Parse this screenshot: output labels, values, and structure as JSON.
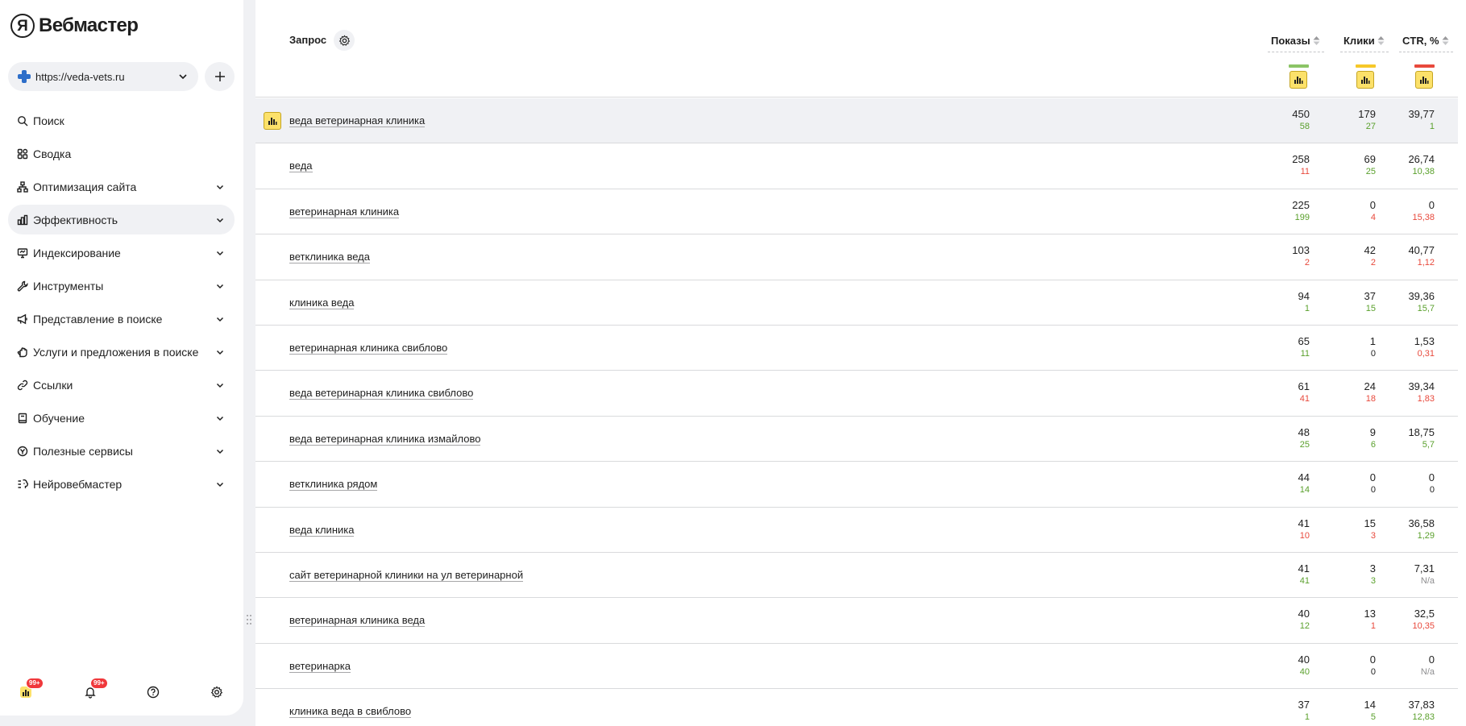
{
  "app": {
    "logo_letter": "Я",
    "title": "Вебмастер"
  },
  "site_selector": {
    "url": "https://veda-vets.ru",
    "add_label": "+"
  },
  "nav": [
    {
      "label": "Поиск",
      "icon": "search-icon",
      "has_chevron": false,
      "active": false
    },
    {
      "label": "Сводка",
      "icon": "grid-icon",
      "has_chevron": false,
      "active": false
    },
    {
      "label": "Оптимизация сайта",
      "icon": "sitemap-icon",
      "has_chevron": true,
      "active": false
    },
    {
      "label": "Эффективность",
      "icon": "bar-chart-icon",
      "has_chevron": true,
      "active": true
    },
    {
      "label": "Индексирование",
      "icon": "monitor-icon",
      "has_chevron": true,
      "active": false
    },
    {
      "label": "Инструменты",
      "icon": "wrench-icon",
      "has_chevron": true,
      "active": false
    },
    {
      "label": "Представление в поиске",
      "icon": "megaphone-icon",
      "has_chevron": true,
      "active": false
    },
    {
      "label": "Услуги и предложения в поиске",
      "icon": "hand-icon",
      "has_chevron": true,
      "active": false
    },
    {
      "label": "Ссылки",
      "icon": "link-icon",
      "has_chevron": true,
      "active": false
    },
    {
      "label": "Обучение",
      "icon": "book-icon",
      "has_chevron": true,
      "active": false
    },
    {
      "label": "Полезные сервисы",
      "icon": "services-icon",
      "has_chevron": true,
      "active": false
    },
    {
      "label": "Нейровебмастер",
      "icon": "neuro-icon",
      "has_chevron": true,
      "active": false
    }
  ],
  "bottom_bar": {
    "reports_badge": "99+",
    "notifications_badge": "99+"
  },
  "table": {
    "query_header": "Запрос",
    "shows_header": "Показы",
    "clicks_header": "Клики",
    "ctr_header": "CTR, %",
    "legend_colors": {
      "shows": "#8bc466",
      "clicks": "#f6c829",
      "ctr": "#e8493c"
    },
    "rows": [
      {
        "query": "веда ветеринарная клиника",
        "shows": "450",
        "shows_delta": "58",
        "shows_trend": "up",
        "clicks": "179",
        "clicks_delta": "27",
        "clicks_trend": "up",
        "ctr": "39,77",
        "ctr_delta": "1",
        "ctr_trend": "up",
        "highlighted": true
      },
      {
        "query": "веда",
        "shows": "258",
        "shows_delta": "11",
        "shows_trend": "down",
        "clicks": "69",
        "clicks_delta": "25",
        "clicks_trend": "up",
        "ctr": "26,74",
        "ctr_delta": "10,38",
        "ctr_trend": "up",
        "highlighted": false
      },
      {
        "query": "ветеринарная клиника",
        "shows": "225",
        "shows_delta": "199",
        "shows_trend": "up",
        "clicks": "0",
        "clicks_delta": "4",
        "clicks_trend": "down",
        "ctr": "0",
        "ctr_delta": "15,38",
        "ctr_trend": "down",
        "highlighted": false
      },
      {
        "query": "ветклиника веда",
        "shows": "103",
        "shows_delta": "2",
        "shows_trend": "down",
        "clicks": "42",
        "clicks_delta": "2",
        "clicks_trend": "down",
        "ctr": "40,77",
        "ctr_delta": "1,12",
        "ctr_trend": "down",
        "highlighted": false
      },
      {
        "query": "клиника веда",
        "shows": "94",
        "shows_delta": "1",
        "shows_trend": "up",
        "clicks": "37",
        "clicks_delta": "15",
        "clicks_trend": "up",
        "ctr": "39,36",
        "ctr_delta": "15,7",
        "ctr_trend": "up",
        "highlighted": false
      },
      {
        "query": "ветеринарная клиника свиблово",
        "shows": "65",
        "shows_delta": "11",
        "shows_trend": "up",
        "clicks": "1",
        "clicks_delta": "0",
        "clicks_trend": "neutral-dark",
        "ctr": "1,53",
        "ctr_delta": "0,31",
        "ctr_trend": "down",
        "highlighted": false
      },
      {
        "query": "веда ветеринарная клиника свиблово",
        "shows": "61",
        "shows_delta": "41",
        "shows_trend": "down",
        "clicks": "24",
        "clicks_delta": "18",
        "clicks_trend": "down",
        "ctr": "39,34",
        "ctr_delta": "1,83",
        "ctr_trend": "down",
        "highlighted": false
      },
      {
        "query": "веда ветеринарная клиника измайлово",
        "shows": "48",
        "shows_delta": "25",
        "shows_trend": "up",
        "clicks": "9",
        "clicks_delta": "6",
        "clicks_trend": "up",
        "ctr": "18,75",
        "ctr_delta": "5,7",
        "ctr_trend": "up",
        "highlighted": false
      },
      {
        "query": "ветклиника рядом",
        "shows": "44",
        "shows_delta": "14",
        "shows_trend": "up",
        "clicks": "0",
        "clicks_delta": "0",
        "clicks_trend": "neutral-dark",
        "ctr": "0",
        "ctr_delta": "0",
        "ctr_trend": "neutral-dark",
        "highlighted": false
      },
      {
        "query": "веда клиника",
        "shows": "41",
        "shows_delta": "10",
        "shows_trend": "down",
        "clicks": "15",
        "clicks_delta": "3",
        "clicks_trend": "down",
        "ctr": "36,58",
        "ctr_delta": "1,29",
        "ctr_trend": "up",
        "highlighted": false
      },
      {
        "query": "сайт ветеринарной клиники на ул ветеринарной",
        "shows": "41",
        "shows_delta": "41",
        "shows_trend": "up",
        "clicks": "3",
        "clicks_delta": "3",
        "clicks_trend": "up",
        "ctr": "7,31",
        "ctr_delta": "N/a",
        "ctr_trend": "neutral",
        "highlighted": false
      },
      {
        "query": "ветеринарная клиника веда",
        "shows": "40",
        "shows_delta": "12",
        "shows_trend": "up",
        "clicks": "13",
        "clicks_delta": "1",
        "clicks_trend": "down",
        "ctr": "32,5",
        "ctr_delta": "10,35",
        "ctr_trend": "down",
        "highlighted": false
      },
      {
        "query": "ветеринарка",
        "shows": "40",
        "shows_delta": "40",
        "shows_trend": "up",
        "clicks": "0",
        "clicks_delta": "0",
        "clicks_trend": "neutral-dark",
        "ctr": "0",
        "ctr_delta": "N/a",
        "ctr_trend": "neutral",
        "highlighted": false
      },
      {
        "query": "клиника веда в свиблово",
        "shows": "37",
        "shows_delta": "1",
        "shows_trend": "up",
        "clicks": "14",
        "clicks_delta": "5",
        "clicks_trend": "up",
        "ctr": "37,83",
        "ctr_delta": "12,83",
        "ctr_trend": "up",
        "highlighted": false
      }
    ]
  }
}
